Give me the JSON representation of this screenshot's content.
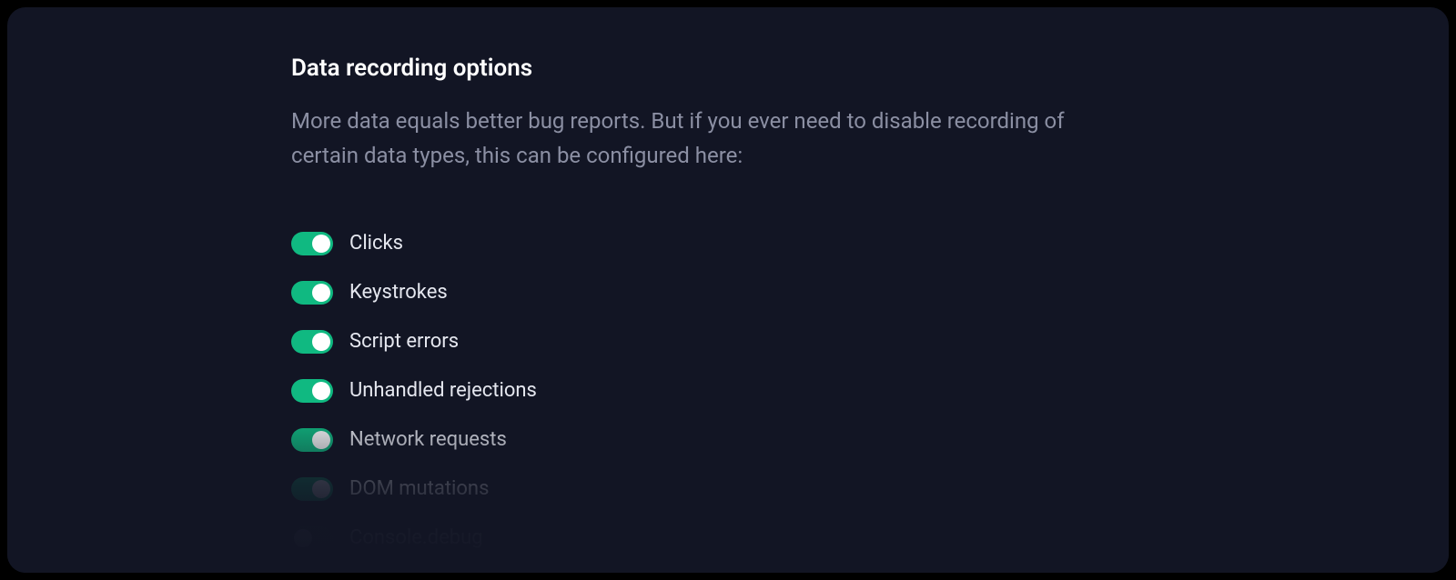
{
  "section": {
    "title": "Data recording options",
    "description": "More data equals better bug reports. But if you ever need to disable recording of certain data types, this can be configured here:"
  },
  "options": [
    {
      "label": "Clicks",
      "enabled": true
    },
    {
      "label": "Keystrokes",
      "enabled": true
    },
    {
      "label": "Script errors",
      "enabled": true
    },
    {
      "label": "Unhandled rejections",
      "enabled": true
    },
    {
      "label": "Network requests",
      "enabled": true
    },
    {
      "label": "DOM mutations",
      "enabled": true
    },
    {
      "label": "Console.debug",
      "enabled": false
    }
  ],
  "colors": {
    "panel_bg": "#121524",
    "toggle_on": "#10b981",
    "toggle_off": "#2a2e42",
    "text_primary": "#ffffff",
    "text_body": "#e5e7ef",
    "text_muted": "#8b8fa3"
  }
}
